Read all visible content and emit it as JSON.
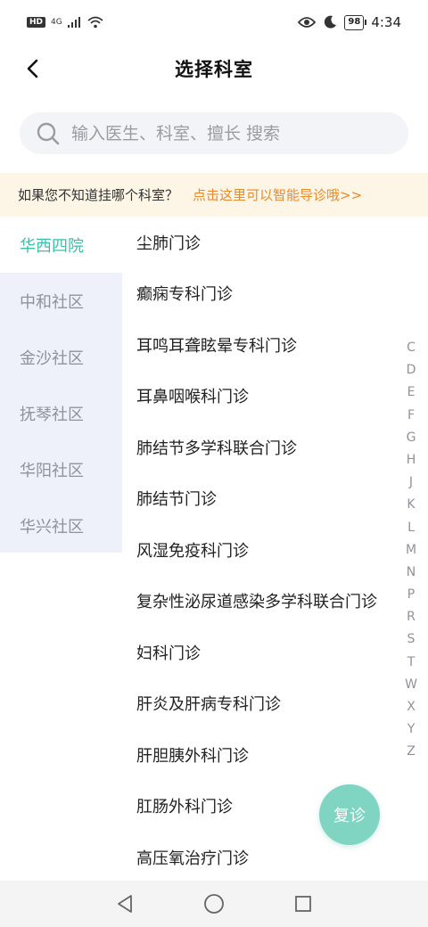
{
  "status_bar": {
    "hd": "HD",
    "network": "4G",
    "battery": "98",
    "time": "4:34"
  },
  "header": {
    "title": "选择科室",
    "back_icon": "chevron-left-icon"
  },
  "search": {
    "placeholder": "输入医生、科室、擅长 搜索",
    "icon": "search-icon"
  },
  "notice": {
    "text": "如果您不知道挂哪个科室？",
    "link": "点击这里可以智能导诊哦>>",
    "link_color": "#e98a2c"
  },
  "sidebar": {
    "items": [
      {
        "label": "华西四院"
      },
      {
        "label": "中和社区"
      },
      {
        "label": "金沙社区"
      },
      {
        "label": "抚琴社区"
      },
      {
        "label": "华阳社区"
      },
      {
        "label": "华兴社区"
      }
    ],
    "active_color": "#3dbfa7"
  },
  "departments": [
    {
      "label": "尘肺门诊"
    },
    {
      "label": "癫痫专科门诊"
    },
    {
      "label": "耳鸣耳聋眩晕专科门诊"
    },
    {
      "label": "耳鼻咽喉科门诊"
    },
    {
      "label": "肺结节多学科联合门诊"
    },
    {
      "label": "肺结节门诊"
    },
    {
      "label": "风湿免疫科门诊"
    },
    {
      "label": "复杂性泌尿道感染多学科联合门诊"
    },
    {
      "label": "妇科门诊"
    },
    {
      "label": "肝炎及肝病专科门诊"
    },
    {
      "label": "肝胆胰外科门诊"
    },
    {
      "label": "肛肠外科门诊"
    },
    {
      "label": "高压氧治疗门诊"
    }
  ],
  "alphabet": [
    "C",
    "D",
    "E",
    "F",
    "G",
    "H",
    "J",
    "K",
    "L",
    "M",
    "N",
    "P",
    "R",
    "S",
    "T",
    "W",
    "X",
    "Y",
    "Z"
  ],
  "fab": {
    "label": "复诊",
    "color": "#7fd5c2"
  }
}
